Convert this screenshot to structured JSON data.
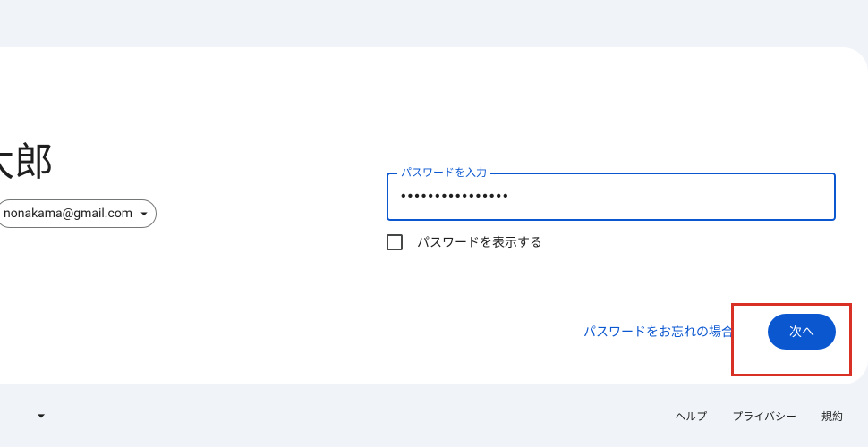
{
  "left": {
    "heading_fragment": "太郎",
    "email_fragment": "nonakama@gmail.com"
  },
  "password": {
    "field_label": "パスワードを入力",
    "masked_value": "••••••••••••••••",
    "show_label": "パスワードを表示する"
  },
  "actions": {
    "forgot": "パスワードをお忘れの場合",
    "next": "次へ"
  },
  "footer": {
    "help": "ヘルプ",
    "privacy": "プライバシー",
    "terms": "規約"
  }
}
